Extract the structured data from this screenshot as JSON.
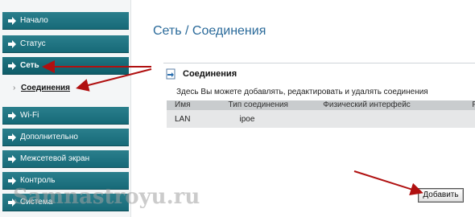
{
  "sidebar": {
    "items": [
      {
        "label": "Начало"
      },
      {
        "label": "Статус"
      },
      {
        "label": "Сеть"
      },
      {
        "label": "Wi-Fi"
      },
      {
        "label": "Дополнительно"
      },
      {
        "label": "Межсетевой экран"
      },
      {
        "label": "Контроль"
      },
      {
        "label": "Система"
      }
    ],
    "subitem": {
      "label": "Соединения"
    }
  },
  "main": {
    "title": "Сеть / Соединения",
    "panel": {
      "title": "Соединения",
      "description": "Здесь Вы можете добавлять, редактировать и удалять соединения"
    },
    "table": {
      "columns": [
        "Имя",
        "Тип соединения",
        "Физический интерфейс",
        "Р"
      ],
      "rows": [
        [
          "LAN",
          "ipoe",
          "",
          ""
        ]
      ]
    },
    "add_button": "Добавить"
  },
  "watermark": "Samnastroyu.ru",
  "colors": {
    "nav_bg": "#1f7481",
    "title": "#2a6a9a",
    "annotation_arrow": "#b01010"
  }
}
